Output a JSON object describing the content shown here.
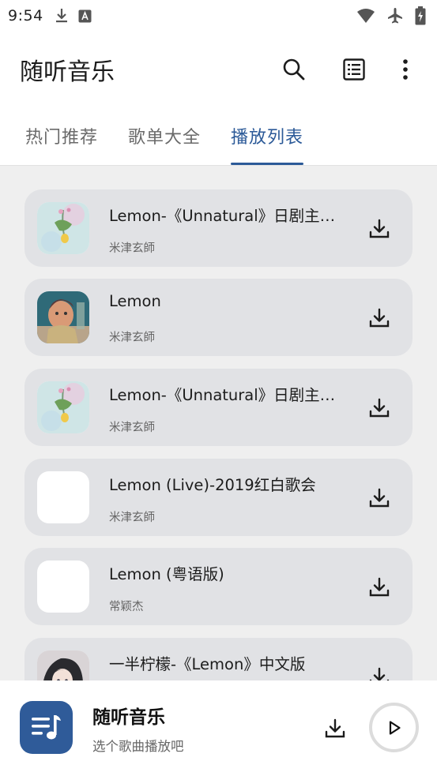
{
  "status_bar": {
    "time": "9:54",
    "left_icons": [
      "download-icon",
      "a-notification-icon"
    ],
    "right_icons": [
      "wifi-icon",
      "airplane-icon",
      "battery-charging-icon"
    ]
  },
  "app_bar": {
    "title": "随听音乐",
    "actions": [
      "search-icon",
      "list-view-icon",
      "more-vert-icon"
    ]
  },
  "tabs": [
    {
      "label": "热门推荐",
      "active": false
    },
    {
      "label": "歌单大全",
      "active": false
    },
    {
      "label": "播放列表",
      "active": true
    }
  ],
  "songs": [
    {
      "title": "Lemon-《Unnatural》日剧主题曲",
      "artist": "米津玄師",
      "cover": "lemon-art"
    },
    {
      "title": "Lemon",
      "artist": "米津玄師",
      "cover": "portrait-art"
    },
    {
      "title": "Lemon-《Unnatural》日剧主题曲",
      "artist": "米津玄師",
      "cover": "lemon-art"
    },
    {
      "title": "Lemon (Live)-2019红白歌会",
      "artist": "米津玄師",
      "cover": "blank"
    },
    {
      "title": "Lemon (粤语版)",
      "artist": "常颖杰",
      "cover": "blank"
    },
    {
      "title": "一半柠檬-《Lemon》中文版",
      "artist": "",
      "cover": "anime-art"
    }
  ],
  "mini_player": {
    "title": "随听音乐",
    "subtitle": "选个歌曲播放吧",
    "accent": "#2f5b99"
  },
  "colors": {
    "accent": "#2c5a98",
    "card_bg": "#e1e2e5",
    "page_bg": "#efefef"
  }
}
